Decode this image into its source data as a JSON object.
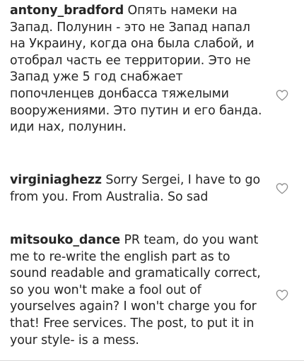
{
  "comments": [
    {
      "username": "antony_bradford",
      "text": "Опять намеки на Запад. Полунин - это не Запад напал на Украину, когда она была слабой, и отобрал часть ее территории. Это не Запад уже 5 год снабжает попочленцев донбасса тяжелыми вооружениями. Это путин и его банда. иди нах, полунин.",
      "like_icon": "heart-outline-icon"
    },
    {
      "username": "virginiaghezz",
      "text": "Sorry Sergei, I have to go from you. From Australia. So sad",
      "like_icon": "heart-outline-icon"
    },
    {
      "username": "mitsouko_dance",
      "text": "PR team, do you want me to re-write the english part as to sound readable and gramatically correct, so you won't make a fool out of yourselves again? I won't charge you for that! Free services. The post, to put it in your style- is a mess.",
      "like_icon": "heart-outline-icon"
    }
  ],
  "colors": {
    "text": "#262626",
    "icon": "#8e8e8e",
    "background": "#ffffff"
  }
}
